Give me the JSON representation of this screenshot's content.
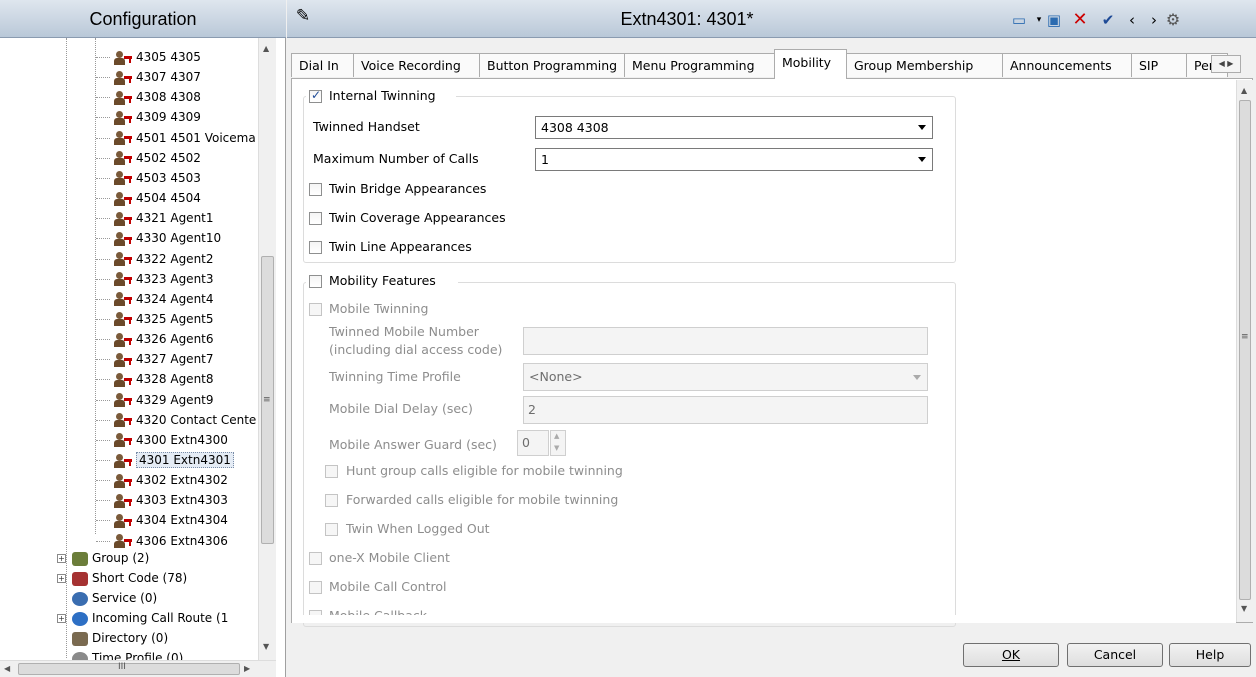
{
  "left_panel": {
    "title": "Configuration",
    "extensions": [
      "4305 4305",
      "4307 4307",
      "4308 4308",
      "4309 4309",
      "4501 4501 Voicema",
      "4502 4502",
      "4503 4503",
      "4504 4504",
      "4321 Agent1",
      "4330 Agent10",
      "4322 Agent2",
      "4323 Agent3",
      "4324 Agent4",
      "4325 Agent5",
      "4326 Agent6",
      "4327 Agent7",
      "4328 Agent8",
      "4329 Agent9",
      "4320 Contact Cente",
      "4300 Extn4300",
      "4301 Extn4301",
      "4302 Extn4302",
      "4303 Extn4303",
      "4304 Extn4304",
      "4306 Extn4306"
    ],
    "groups": [
      {
        "label": "Group (2)",
        "icon": "group-icon"
      },
      {
        "label": "Short Code (78)",
        "icon": "short-code-icon"
      },
      {
        "label": "Service (0)",
        "icon": "service-icon"
      },
      {
        "label": "Incoming Call Route (1",
        "icon": "incoming-call-route-icon"
      },
      {
        "label": "Directory (0)",
        "icon": "directory-icon"
      },
      {
        "label": "Time Profile (0)",
        "icon": "time-profile-icon"
      }
    ],
    "hscroll_label": "III"
  },
  "header": {
    "title": "Extn4301: 4301*"
  },
  "tabs": [
    "Dial In",
    "Voice Recording",
    "Button Programming",
    "Menu Programming",
    "Mobility",
    "Group Membership",
    "Announcements",
    "SIP",
    "Per"
  ],
  "internal_twinning": {
    "label": "Internal Twinning",
    "twinned_handset_label": "Twinned Handset",
    "twinned_handset_value": "4308 4308",
    "max_calls_label": "Maximum Number of Calls",
    "max_calls_value": "1",
    "twin_bridge": "Twin Bridge Appearances",
    "twin_coverage": "Twin Coverage Appearances",
    "twin_line": "Twin Line Appearances"
  },
  "mobility_features": {
    "label": "Mobility Features",
    "mobile_twinning": "Mobile Twinning",
    "twinned_mobile_number_label_1": "Twinned Mobile Number",
    "twinned_mobile_number_label_2": "(including dial access code)",
    "twinning_time_profile_label": "Twinning Time Profile",
    "twinning_time_profile_value": "<None>",
    "mobile_dial_delay_label": "Mobile Dial Delay (sec)",
    "mobile_dial_delay_value": "2",
    "mobile_answer_guard_label": "Mobile Answer Guard (sec)",
    "mobile_answer_guard_value": "0",
    "hunt_group": "Hunt group calls eligible for mobile twinning",
    "forwarded": "Forwarded calls eligible for mobile twinning",
    "twin_logged_out": "Twin When Logged Out",
    "onex": "one-X Mobile Client",
    "mobile_call_control": "Mobile Call Control",
    "mobile_callback": "Mobile Callback"
  },
  "buttons": {
    "ok": "OK",
    "cancel": "Cancel",
    "help": "Help"
  }
}
